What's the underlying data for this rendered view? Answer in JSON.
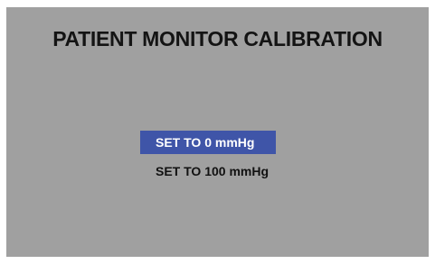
{
  "screen": {
    "title": "PATIENT MONITOR CALIBRATION",
    "background_color": "#a0a0a0"
  },
  "menu": {
    "selected_color": "#3f55a8",
    "items": [
      {
        "label": "SET TO 0 mmHg",
        "selected": true
      },
      {
        "label": "SET TO 100 mmHg",
        "selected": false
      }
    ]
  }
}
